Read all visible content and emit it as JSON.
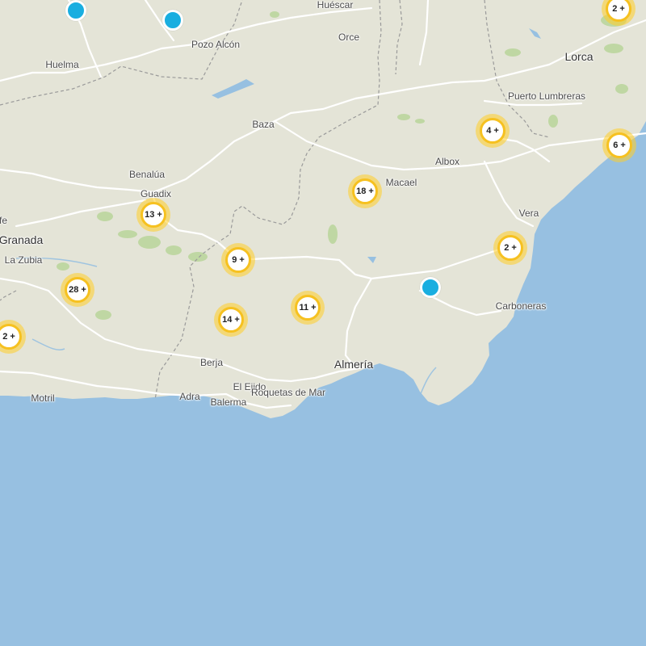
{
  "map": {
    "colors": {
      "land": "#e4e4d7",
      "sea": "#97c0e1",
      "road": "#ffffff",
      "border": "#9a9a9a",
      "park": "#b9d59a",
      "cluster": "#f6c120",
      "marker": "#19aee0"
    },
    "places": [
      {
        "name": "Huéscar",
        "type": "town"
      },
      {
        "name": "Pozo Alcón",
        "type": "town"
      },
      {
        "name": "Orce",
        "type": "town"
      },
      {
        "name": "Huelma",
        "type": "town"
      },
      {
        "name": "Lorca",
        "type": "city"
      },
      {
        "name": "Puerto Lumbreras",
        "type": "town"
      },
      {
        "name": "Baza",
        "type": "town"
      },
      {
        "name": "Albox",
        "type": "town"
      },
      {
        "name": "Benalúa",
        "type": "town"
      },
      {
        "name": "Guadix",
        "type": "town"
      },
      {
        "name": "Macael",
        "type": "town"
      },
      {
        "name": "Vera",
        "type": "town"
      },
      {
        "name": "fe",
        "type": "town"
      },
      {
        "name": "Granada",
        "type": "city"
      },
      {
        "name": "La Zubia",
        "type": "town"
      },
      {
        "name": "Carboneras",
        "type": "town"
      },
      {
        "name": "Berja",
        "type": "town"
      },
      {
        "name": "Almería",
        "type": "city"
      },
      {
        "name": "El Ejido",
        "type": "town"
      },
      {
        "name": "Motril",
        "type": "town"
      },
      {
        "name": "Adra",
        "type": "town"
      },
      {
        "name": "Balerma",
        "type": "town"
      },
      {
        "name": "Roquetas de Mar",
        "type": "town"
      }
    ],
    "clusters": [
      {
        "id": "top-right",
        "label": "2 +"
      },
      {
        "id": "lorca-south",
        "label": "4 +"
      },
      {
        "id": "coast-east",
        "label": "6 +"
      },
      {
        "id": "macael",
        "label": "18 +"
      },
      {
        "id": "guadix",
        "label": "13 +"
      },
      {
        "id": "vera",
        "label": "2 +"
      },
      {
        "id": "alpujarra",
        "label": "9 +"
      },
      {
        "id": "granada-south",
        "label": "28 +"
      },
      {
        "id": "tabernas",
        "label": "11 +"
      },
      {
        "id": "berja",
        "label": "14 +"
      },
      {
        "id": "west-edge",
        "label": "2 +"
      }
    ],
    "markers": [
      {
        "id": "north-west"
      },
      {
        "id": "pozo-alcon"
      },
      {
        "id": "nijar"
      }
    ]
  }
}
